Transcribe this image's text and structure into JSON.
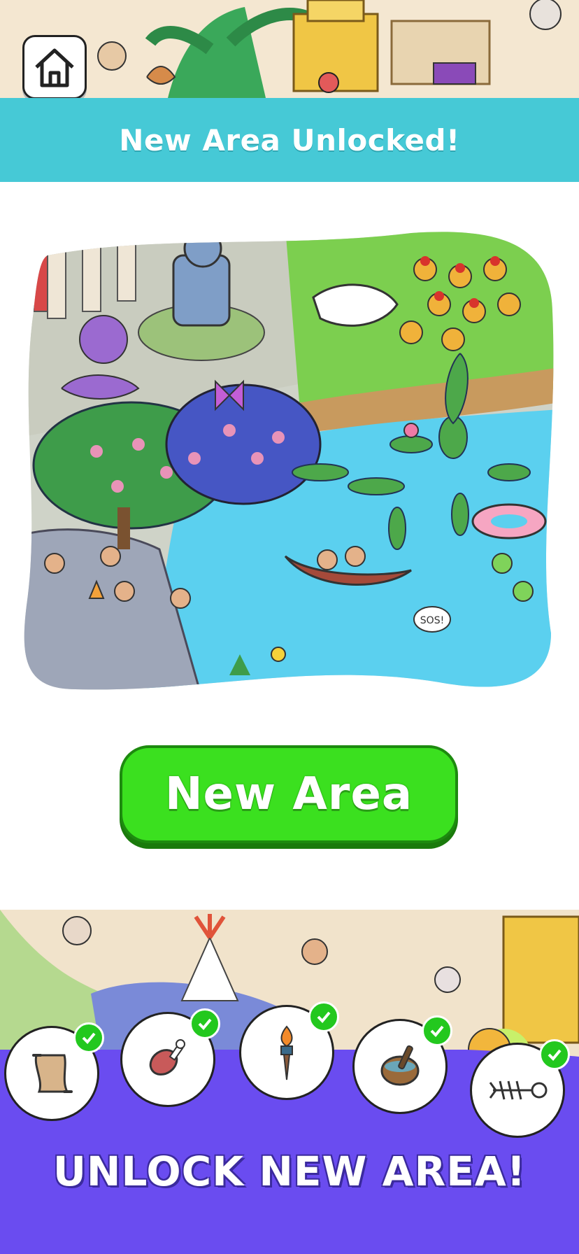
{
  "header": {
    "banner_text": "New Area Unlocked!",
    "home_icon": "home-icon"
  },
  "main": {
    "button_label": "New Area",
    "speech_bubble": "SOS!"
  },
  "footer": {
    "unlock_text": "UNLOCK NEW AREA!",
    "items": [
      {
        "icon": "scroll-map-icon",
        "collected": true
      },
      {
        "icon": "meat-drumstick-icon",
        "collected": true
      },
      {
        "icon": "torch-icon",
        "collected": true
      },
      {
        "icon": "mortar-pestle-icon",
        "collected": true
      },
      {
        "icon": "fish-bone-icon",
        "collected": true
      }
    ]
  },
  "colors": {
    "banner": "#46c9d6",
    "button": "#3be01f",
    "purple": "#6a4cf0",
    "check": "#23c81e"
  }
}
